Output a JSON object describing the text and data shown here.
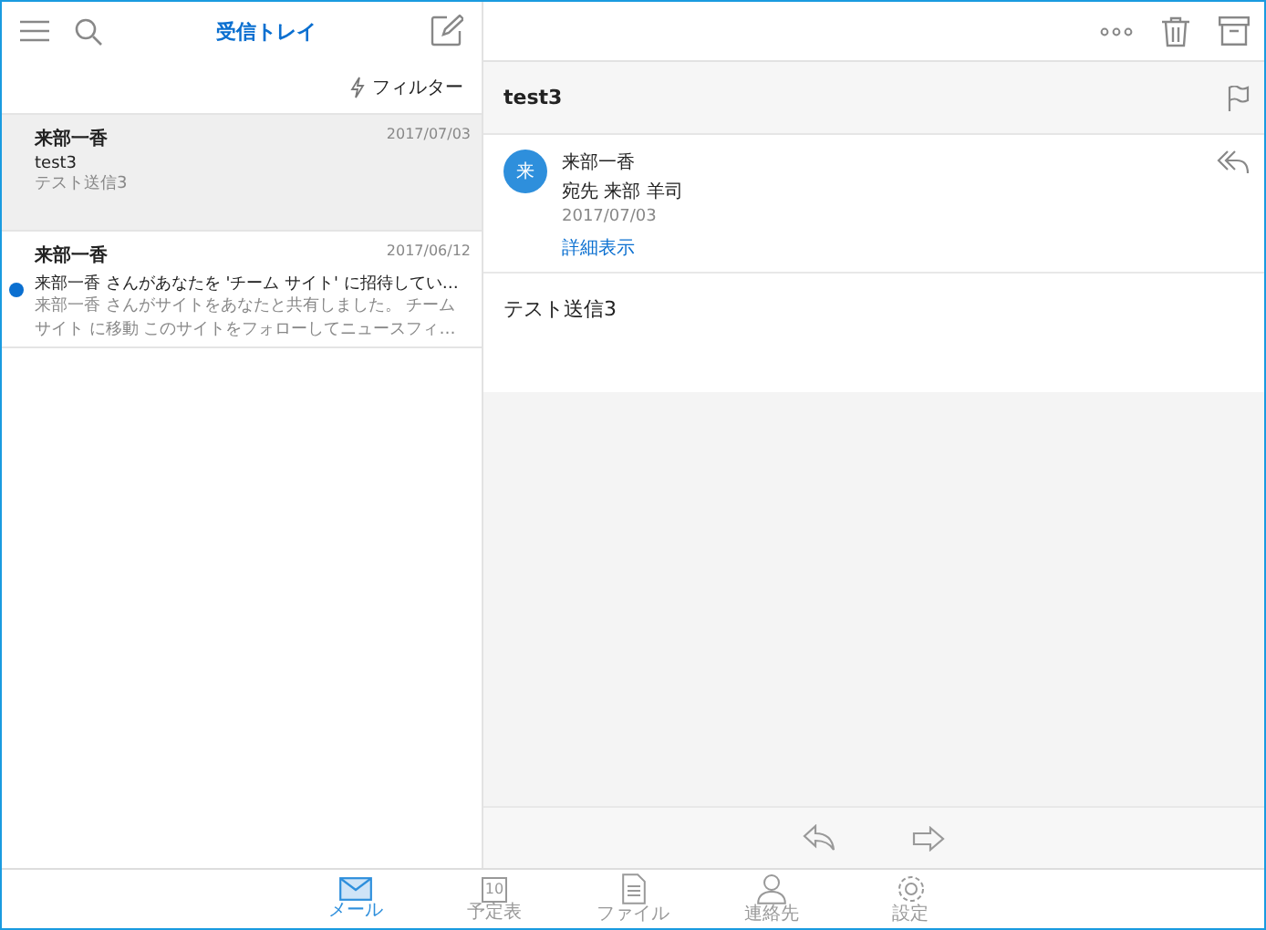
{
  "header": {
    "title": "受信トレイ"
  },
  "filter": {
    "label": "フィルター"
  },
  "messages": [
    {
      "sender": "来部一香",
      "date": "2017/07/03",
      "subject": "test3",
      "preview_lines": [
        "テスト送信3"
      ],
      "selected": true,
      "unread": false
    },
    {
      "sender": "来部一香",
      "date": "2017/06/12",
      "subject": "来部一香 さんがあなたを 'チーム サイト' に招待してい…",
      "preview_lines": [
        "来部一香 さんがサイトをあなたと共有しました。 チーム",
        "サイト に移動 このサイトをフォローしてニュースフィ…"
      ],
      "selected": false,
      "unread": true
    }
  ],
  "reading": {
    "subject": "test3",
    "avatar": "来",
    "sender": "来部一香",
    "to": "宛先 来部 羊司",
    "date": "2017/07/03",
    "details_link": "詳細表示",
    "body": "テスト送信3"
  },
  "tabs": [
    {
      "kind": "mail",
      "label": "メール",
      "selected": true
    },
    {
      "kind": "calendar",
      "label": "予定表",
      "icon_text": "10",
      "selected": false
    },
    {
      "kind": "files",
      "label": "ファイル",
      "selected": false
    },
    {
      "kind": "contacts",
      "label": "連絡先",
      "selected": false
    },
    {
      "kind": "settings",
      "label": "設定",
      "selected": false
    }
  ]
}
